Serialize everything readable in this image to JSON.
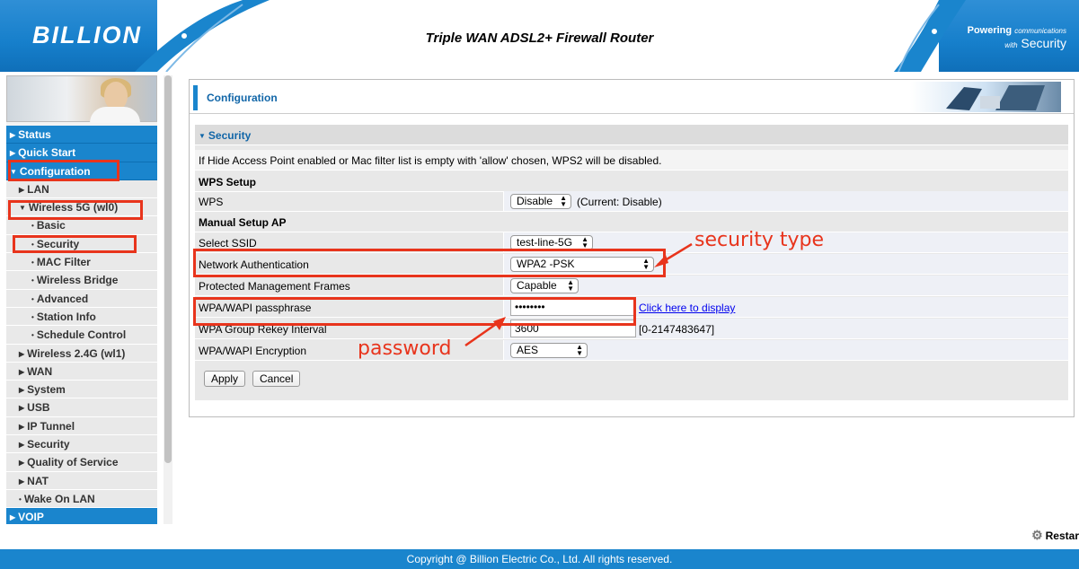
{
  "header": {
    "logo": "BILLION",
    "title": "Triple WAN ADSL2+ Firewall Router",
    "tagline_bold": "Powering",
    "tagline_small": "communications",
    "tagline_with": "with",
    "tagline_big": "Security"
  },
  "sidebar": {
    "items": [
      {
        "label": "Status"
      },
      {
        "label": "Quick Start"
      },
      {
        "label": "Configuration"
      },
      {
        "label": "LAN"
      },
      {
        "label": "Wireless 5G (wl0)"
      },
      {
        "label": "Basic"
      },
      {
        "label": "Security"
      },
      {
        "label": "MAC Filter"
      },
      {
        "label": "Wireless Bridge"
      },
      {
        "label": "Advanced"
      },
      {
        "label": "Station Info"
      },
      {
        "label": "Schedule Control"
      },
      {
        "label": "Wireless 2.4G (wl1)"
      },
      {
        "label": "WAN"
      },
      {
        "label": "System"
      },
      {
        "label": "USB"
      },
      {
        "label": "IP Tunnel"
      },
      {
        "label": "Security"
      },
      {
        "label": "Quality of Service"
      },
      {
        "label": "NAT"
      },
      {
        "label": "Wake On LAN"
      },
      {
        "label": "VOIP"
      }
    ]
  },
  "main": {
    "section_title": "Configuration",
    "panel_title": "Security",
    "notice": "If Hide Access Point enabled or Mac filter list is empty with 'allow' chosen, WPS2 will be disabled.",
    "wps_setup": "WPS Setup",
    "wps_label": "WPS",
    "wps_value": "Disable",
    "wps_current": "(Current: Disable)",
    "manual_setup": "Manual Setup AP",
    "ssid_label": "Select SSID",
    "ssid_value": "test-line-5G",
    "auth_label": "Network Authentication",
    "auth_value": "WPA2 -PSK",
    "pmf_label": "Protected Management Frames",
    "pmf_value": "Capable",
    "pass_label": "WPA/WAPI passphrase",
    "pass_value": "••••••••",
    "pass_link": "Click here to display",
    "rekey_label": "WPA Group Rekey Interval",
    "rekey_value": "3600",
    "rekey_range": "[0-2147483647]",
    "enc_label": "WPA/WAPI Encryption",
    "enc_value": "AES",
    "apply": "Apply",
    "cancel": "Cancel"
  },
  "annotations": {
    "security_type": "security type",
    "password": "password",
    "color": "#e8341c"
  },
  "restart": "Restar",
  "footer": "Copyright @ Billion Electric Co., Ltd. All rights reserved."
}
